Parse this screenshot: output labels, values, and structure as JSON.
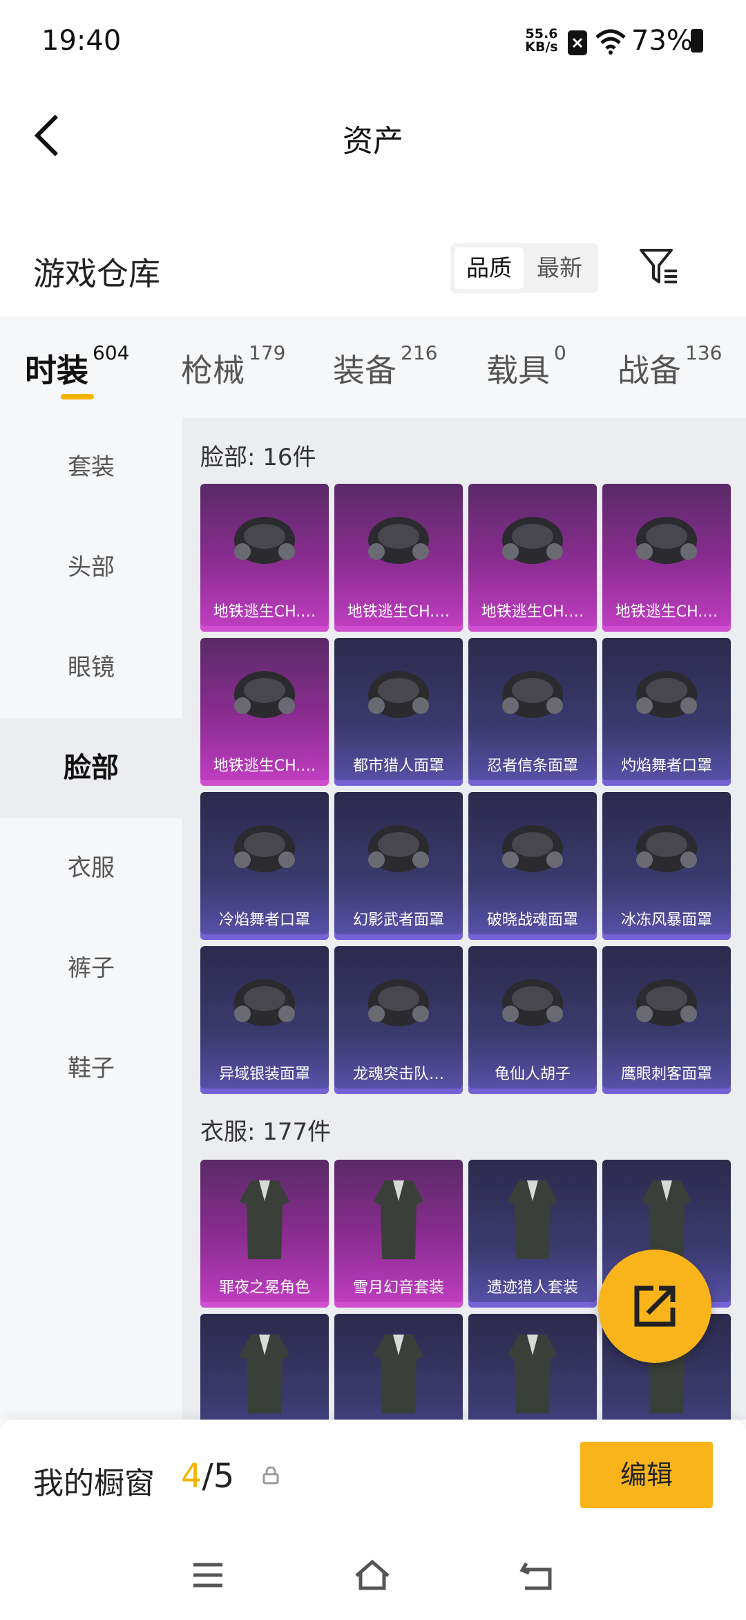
{
  "status_bar": {
    "time": "19:40",
    "net_speed_value": "55.6",
    "net_speed_unit": "KB/s",
    "battery": "73%"
  },
  "header": {
    "title": "资产"
  },
  "warehouse": {
    "title": "游戏仓库",
    "sort_options": [
      "品质",
      "最新"
    ],
    "sort_selected": "品质"
  },
  "category_tabs": [
    {
      "label": "时装",
      "count": "604",
      "active": true
    },
    {
      "label": "枪械",
      "count": "179",
      "active": false
    },
    {
      "label": "装备",
      "count": "216",
      "active": false
    },
    {
      "label": "载具",
      "count": "0",
      "active": false
    },
    {
      "label": "战备",
      "count": "136",
      "active": false
    }
  ],
  "sidebar": {
    "items": [
      "套装",
      "头部",
      "眼镜",
      "脸部",
      "衣服",
      "裤子",
      "鞋子"
    ],
    "active": "脸部"
  },
  "sections": [
    {
      "title": "脸部: 16件",
      "items": [
        {
          "name": "地铁逃生CH.…",
          "rarity": "purple",
          "icon": "gas-mask-icon"
        },
        {
          "name": "地铁逃生CH.…",
          "rarity": "purple",
          "icon": "black-half-mask-icon"
        },
        {
          "name": "地铁逃生CH.…",
          "rarity": "purple",
          "icon": "neck-gaiter-icon"
        },
        {
          "name": "地铁逃生CH.…",
          "rarity": "purple",
          "icon": "respirator-icon"
        },
        {
          "name": "地铁逃生CH.…",
          "rarity": "purple",
          "icon": "studded-mask-icon"
        },
        {
          "name": "都市猎人面罩",
          "rarity": "blue",
          "icon": "bandana-icon"
        },
        {
          "name": "忍者信条面罩",
          "rarity": "blue",
          "icon": "ninja-mask-icon"
        },
        {
          "name": "灼焰舞者口罩",
          "rarity": "blue",
          "icon": "flame-gaiter-icon"
        },
        {
          "name": "冷焰舞者口罩",
          "rarity": "blue",
          "icon": "white-flame-gaiter-icon"
        },
        {
          "name": "幻影武者面罩",
          "rarity": "blue",
          "icon": "samurai-mask-icon"
        },
        {
          "name": "破晓战魂面罩",
          "rarity": "blue",
          "icon": "wolf-mask-icon"
        },
        {
          "name": "冰冻风暴面罩",
          "rarity": "blue",
          "icon": "green-knit-gaiter-icon"
        },
        {
          "name": "异域银装面罩",
          "rarity": "blue",
          "icon": "silver-mask-icon"
        },
        {
          "name": "龙魂突击队…",
          "rarity": "blue",
          "icon": "red-visor-mask-icon"
        },
        {
          "name": "龟仙人胡子",
          "rarity": "blue",
          "icon": "white-beard-icon"
        },
        {
          "name": "鹰眼刺客面罩",
          "rarity": "blue",
          "icon": "plague-mask-icon"
        }
      ]
    },
    {
      "title": "衣服: 177件",
      "items": [
        {
          "name": "罪夜之冕角色",
          "rarity": "purple",
          "icon": "outfit-icon"
        },
        {
          "name": "雪月幻音套装",
          "rarity": "purple",
          "icon": "white-dress-icon"
        },
        {
          "name": "遗迹猎人套装",
          "rarity": "blue",
          "icon": "camo-suit-icon"
        },
        {
          "name": "装",
          "rarity": "blue",
          "icon": "checkered-outfit-icon"
        },
        {
          "name": "",
          "rarity": "blue",
          "icon": "orange-suit-icon"
        },
        {
          "name": "",
          "rarity": "blue",
          "icon": "blue-jacket-icon"
        },
        {
          "name": "",
          "rarity": "blue",
          "icon": "racing-jacket-icon"
        },
        {
          "name": "",
          "rarity": "blue",
          "icon": "dress-outfit-icon"
        }
      ]
    }
  ],
  "showcase": {
    "label": "我的橱窗",
    "current": "4",
    "total": "/5",
    "edit_label": "编辑"
  },
  "colors": {
    "accent": "#f8b41a",
    "purple_card": "#8d2d93",
    "blue_card": "#3b3a6e"
  }
}
